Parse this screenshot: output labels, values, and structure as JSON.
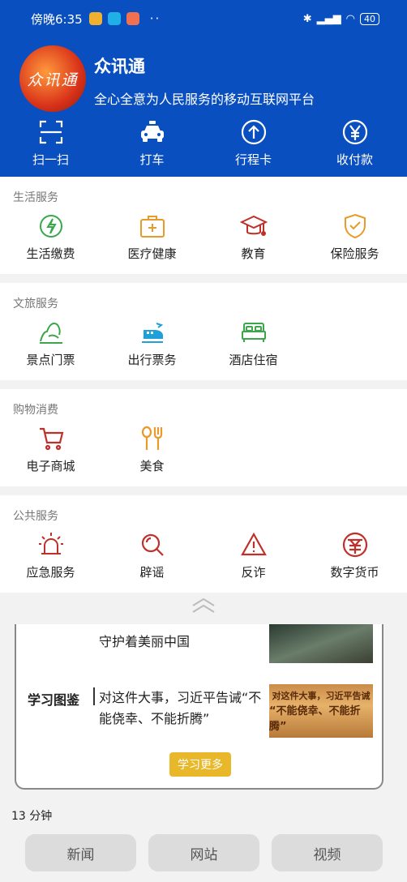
{
  "status_bar": {
    "time": "傍晚6:35",
    "dots": "··",
    "battery": "40"
  },
  "header": {
    "logo_text": "众讯通",
    "title": "众讯通",
    "subtitle": "全心全意为人民服务的移动互联网平台",
    "quick_actions": [
      {
        "label": "扫一扫",
        "icon": "scan-icon"
      },
      {
        "label": "打车",
        "icon": "taxi-icon"
      },
      {
        "label": "行程卡",
        "icon": "arrow-up-circle-icon"
      },
      {
        "label": "收付款",
        "icon": "yen-circle-icon"
      }
    ]
  },
  "sections": [
    {
      "title": "生活服务",
      "items": [
        {
          "label": "生活缴费",
          "icon": "bolt-icon"
        },
        {
          "label": "医疗健康",
          "icon": "medical-kit-icon"
        },
        {
          "label": "教育",
          "icon": "graduation-cap-icon"
        },
        {
          "label": "保险服务",
          "icon": "shield-check-icon"
        }
      ]
    },
    {
      "title": "文旅服务",
      "items": [
        {
          "label": "景点门票",
          "icon": "mountain-icon"
        },
        {
          "label": "出行票务",
          "icon": "train-icon"
        },
        {
          "label": "酒店住宿",
          "icon": "bed-icon"
        }
      ]
    },
    {
      "title": "购物消费",
      "items": [
        {
          "label": "电子商城",
          "icon": "cart-icon"
        },
        {
          "label": "美食",
          "icon": "food-icon"
        }
      ]
    },
    {
      "title": "公共服务",
      "items": [
        {
          "label": "应急服务",
          "icon": "alarm-light-icon"
        },
        {
          "label": "辟谣",
          "icon": "search-icon"
        },
        {
          "label": "反诈",
          "icon": "warning-icon"
        },
        {
          "label": "数字货币",
          "icon": "digital-currency-icon"
        }
      ]
    }
  ],
  "learning": {
    "row1_text": "守护着美丽中国",
    "label": "学习图鉴",
    "text": "对这件大事，习近平告诫“不能侥幸、不能折腾”",
    "thumb_text_1": "对这件大事，习近平告诫",
    "thumb_text_2": "“不能侥幸、不能折腾”",
    "button": "学习更多"
  },
  "minutes": "13 分钟",
  "tabs": [
    "新闻",
    "网站",
    "视频"
  ],
  "colors": {
    "header": "#0a4fc0",
    "green": "#3aa84a",
    "orange": "#e89a2a",
    "red": "#c0302a",
    "button": "#e8b82a"
  }
}
